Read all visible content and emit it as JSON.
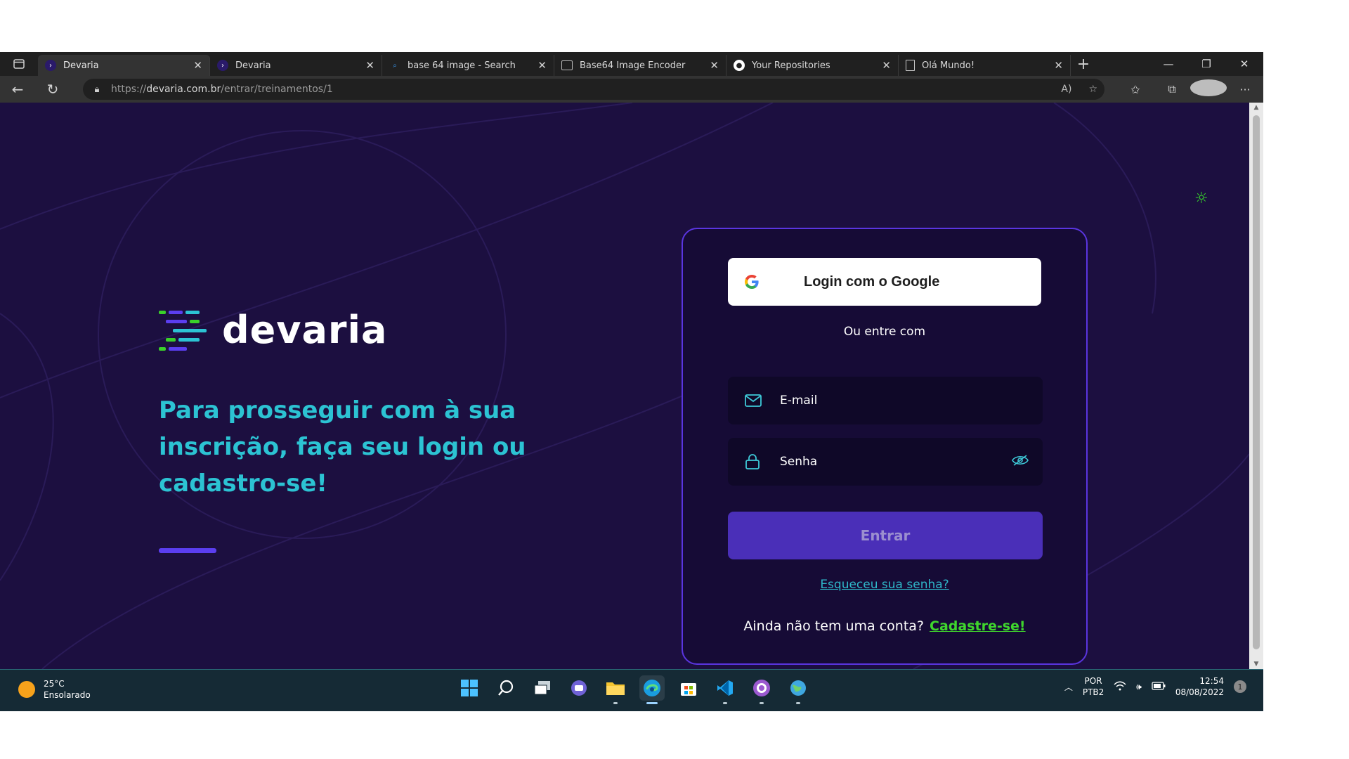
{
  "browser": {
    "tabs": [
      {
        "title": "Devaria",
        "icon": "devaria-favicon",
        "active": true
      },
      {
        "title": "Devaria",
        "icon": "devaria-favicon",
        "active": false
      },
      {
        "title": "base 64 image - Search",
        "icon": "search-favicon",
        "active": false
      },
      {
        "title": "Base64 Image Encoder",
        "icon": "image-favicon",
        "active": false
      },
      {
        "title": "Your Repositories",
        "icon": "github-favicon",
        "active": false
      },
      {
        "title": "Olá Mundo!",
        "icon": "page-favicon",
        "active": false
      }
    ],
    "url_scheme": "https://",
    "url_host": "devaria.com.br",
    "url_path": "/entrar/treinamentos/1"
  },
  "page": {
    "logo_text": "devaria",
    "headline": "Para prosseguir com à sua inscrição, faça seu login ou cadastro-se!",
    "login": {
      "google_button": "Login com o Google",
      "divider_text": "Ou entre com",
      "email_placeholder": "E-mail",
      "password_placeholder": "Senha",
      "submit_button": "Entrar",
      "forgot_link": "Esqueceu sua senha?",
      "signup_prompt": "Ainda não tem uma conta?",
      "signup_link": "Cadastre-se!"
    },
    "colors": {
      "background": "#1c0f40",
      "accent_cyan": "#2cc3d3",
      "accent_green": "#3fd62d",
      "accent_purple": "#5b3ef0"
    }
  },
  "taskbar": {
    "weather_temp": "25°C",
    "weather_desc": "Ensolarado",
    "lang_top": "POR",
    "lang_bottom": "PTB2",
    "time": "12:54",
    "date": "08/08/2022",
    "notification_count": "1"
  }
}
